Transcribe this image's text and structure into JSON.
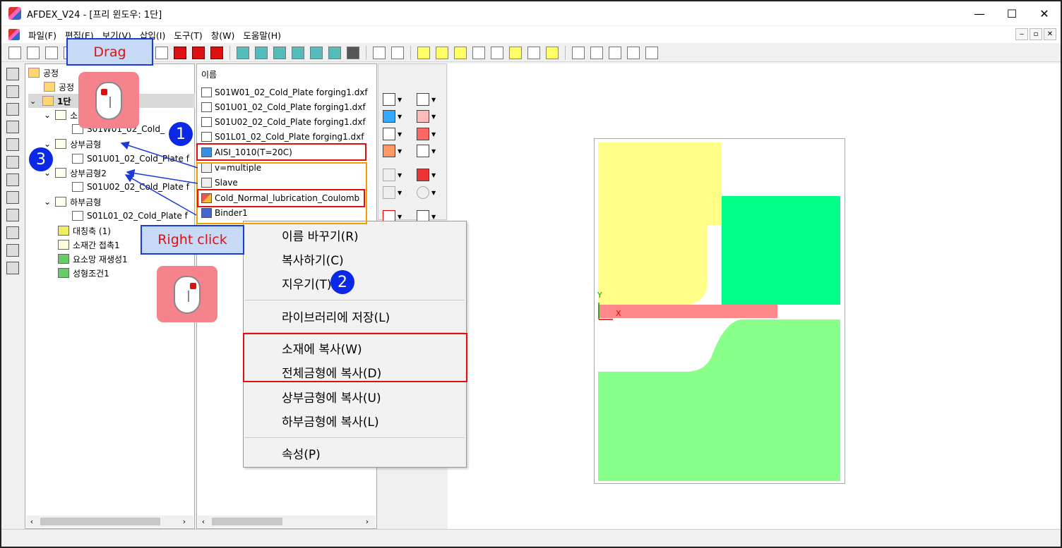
{
  "window": {
    "title": "AFDEX_V24 - [프리 윈도우: 1단]",
    "controls": {
      "minimize": "—",
      "maximize": "☐",
      "close": "✕"
    }
  },
  "menu": {
    "items": [
      "파일(F)",
      "편집(E)",
      "보기(V)",
      "삽입(I)",
      "도구(T)",
      "창(W)",
      "도움말(H)"
    ],
    "mdi": [
      "‒",
      "▫",
      "✕"
    ]
  },
  "tree": {
    "root": "공정",
    "items": {
      "process_folder": "공정",
      "stage1": "1단",
      "material_label": "소재",
      "material_file": "S01W01_02_Cold_",
      "upper_die": "상부금형",
      "upper_die_file": "S01U01_02_Cold_Plate f",
      "upper_die2": "상부금형2",
      "upper_die2_file": "S01U02_02_Cold_Plate f",
      "lower_die": "하부금형",
      "lower_die_file": "S01L01_02_Cold_Plate f",
      "symmetry": "대칭축 (1)",
      "contact": "소재간 접촉1",
      "remesh": "요소망 재생성1",
      "forming": "성형조건1"
    }
  },
  "list": {
    "header": "이름",
    "files": [
      "S01W01_02_Cold_Plate forging1.dxf",
      "S01U01_02_Cold_Plate forging1.dxf",
      "S01U02_02_Cold_Plate forging1.dxf",
      "S01L01_02_Cold_Plate forging1.dxf"
    ],
    "material": "AISI_1010(T=20C)",
    "velocity": "v=multiple",
    "slave": "Slave",
    "lubrication": "Cold_Normal_lubrication_Coulomb",
    "binder": "Binder1"
  },
  "context_menu": {
    "rename": "이름 바꾸기(R)",
    "copy": "복사하기(C)",
    "delete": "지우기(T)",
    "save_library": "라이브러리에 저장(L)",
    "copy_material": "소재에 복사(W)",
    "copy_all_dies": "전체금형에 복사(D)",
    "copy_upper": "상부금형에 복사(U)",
    "copy_lower": "하부금형에 복사(L)",
    "properties": "속성(P)"
  },
  "viewport": {
    "axis_y": "Y",
    "axis_x": "X",
    "colors": {
      "upper_die": "#ffff88",
      "upper_die2": "#00ff88",
      "workpiece": "#ff8888",
      "lower_die": "#88ff88"
    }
  },
  "annotations": {
    "drag_label": "Drag",
    "right_click_label": "Right click",
    "step1": "1",
    "step2": "2",
    "step3": "3",
    "highlight_red": "#e01010",
    "highlight_orange": "#f0a000",
    "arrow_blue": "#1a3bd8"
  }
}
